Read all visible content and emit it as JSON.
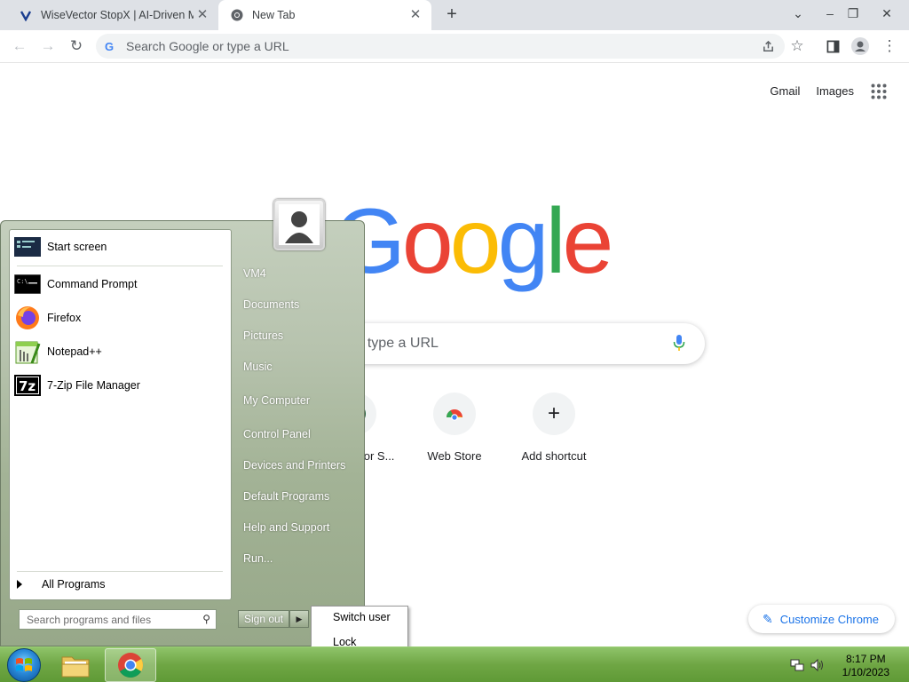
{
  "browser": {
    "tabs": [
      {
        "title": "WiseVector StopX | AI-Driven Ma"
      },
      {
        "title": "New Tab"
      }
    ],
    "omnibox_placeholder": "Search Google or type a URL"
  },
  "ntp": {
    "links": [
      "Gmail",
      "Images"
    ],
    "logo_letters": [
      {
        "ch": "G",
        "color": "#4285f4"
      },
      {
        "ch": "o",
        "color": "#ea4335"
      },
      {
        "ch": "o",
        "color": "#fbbc05"
      },
      {
        "ch": "g",
        "color": "#4285f4"
      },
      {
        "ch": "l",
        "color": "#34a853"
      },
      {
        "ch": "e",
        "color": "#ea4335"
      }
    ],
    "search_placeholder": "Search Google or type a URL",
    "shortcuts": [
      {
        "label": "WiseVector S...",
        "icon": "W"
      },
      {
        "label": "Web Store",
        "icon": "web-store"
      },
      {
        "label": "Add shortcut",
        "icon": "+"
      }
    ],
    "customize_label": "Customize Chrome"
  },
  "start_menu": {
    "programs": [
      {
        "label": "Start screen",
        "icon": "start-screen-icon"
      },
      {
        "label": "Command Prompt",
        "icon": "command-prompt-icon"
      },
      {
        "label": "Firefox",
        "icon": "firefox-icon"
      },
      {
        "label": "Notepad++",
        "icon": "notepad-plus-plus-icon"
      },
      {
        "label": "7-Zip File Manager",
        "icon": "7zip-icon"
      }
    ],
    "all_programs": "All Programs",
    "search_placeholder": "Search programs and files",
    "right_items": [
      "VM4",
      "Documents",
      "Pictures",
      "Music",
      "My Computer",
      "Control Panel",
      "Devices and Printers",
      "Default Programs",
      "Help and Support",
      "Run..."
    ],
    "signout_label": "Sign out",
    "power_menu": [
      "Switch user",
      "Lock"
    ]
  },
  "taskbar": {
    "time": "8:17 PM",
    "date": "1/10/2023"
  }
}
